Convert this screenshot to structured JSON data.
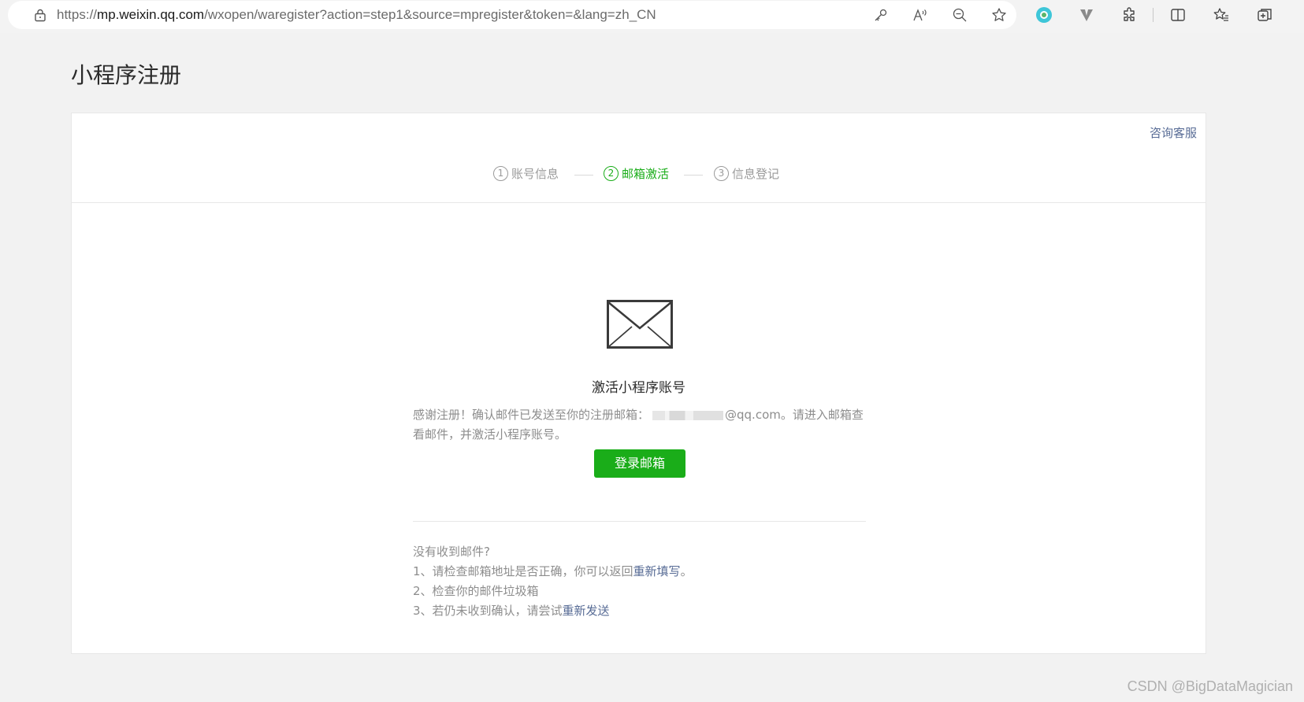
{
  "browser": {
    "url_prefix": "https://",
    "url_host": "mp.weixin.qq.com",
    "url_path": "/wxopen/waregister?action=step1&source=mpregister&token=&lang=zh_CN",
    "address_icons": [
      "key-icon",
      "read-aloud-icon",
      "zoom-out-icon",
      "favorite-star-icon"
    ],
    "toolbar_icons": [
      "extension-colorful-icon",
      "extension-v-icon",
      "extensions-puzzle-icon",
      "split-screen-icon",
      "favorites-icon",
      "collections-icon"
    ]
  },
  "page": {
    "title": "小程序注册",
    "consult_link": "咨询客服"
  },
  "steps": [
    {
      "num": "1",
      "label": "账号信息",
      "active": false
    },
    {
      "num": "2",
      "label": "邮箱激活",
      "active": true
    },
    {
      "num": "3",
      "label": "信息登记",
      "active": false
    }
  ],
  "activation": {
    "title": "激活小程序账号",
    "desc_prefix": "感谢注册！确认邮件已发送至你的注册邮箱：",
    "desc_email_suffix": "@qq.com",
    "desc_suffix": "。请进入邮箱查看邮件，并激活小程序账号。",
    "login_button": "登录邮箱"
  },
  "tips": {
    "heading": "没有收到邮件?",
    "line1_text": "1、请检查邮箱地址是否正确，你可以返回",
    "line1_link": "重新填写",
    "line1_end": "。",
    "line2_text": "2、检查你的邮件垃圾箱",
    "line3_text": "3、若仍未收到确认，请尝试",
    "line3_link": "重新发送"
  },
  "watermark": "CSDN @BigDataMagician",
  "colors": {
    "accent_green": "#1aad19",
    "link_blue": "#576b95"
  }
}
